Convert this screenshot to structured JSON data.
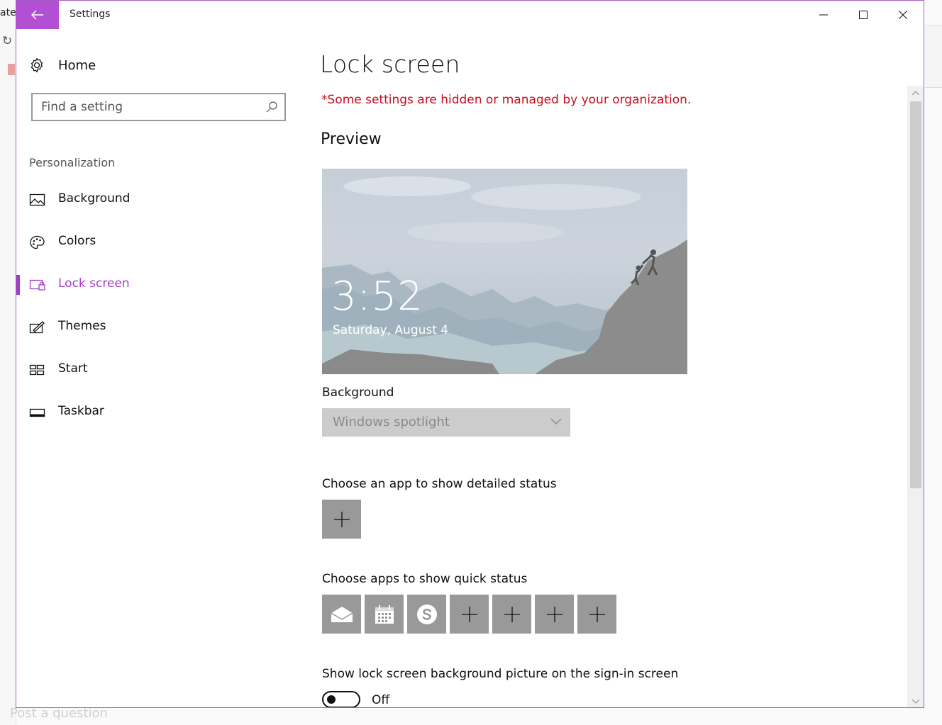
{
  "background_app": {
    "tab_fragment": "ate",
    "bottom_text": "Post a question"
  },
  "window": {
    "title": "Settings"
  },
  "sidebar": {
    "home_label": "Home",
    "search_placeholder": "Find a setting",
    "section_label": "Personalization",
    "items": [
      {
        "label": "Background",
        "icon": "picture-icon"
      },
      {
        "label": "Colors",
        "icon": "palette-icon"
      },
      {
        "label": "Lock screen",
        "icon": "lock-screen-icon",
        "active": true
      },
      {
        "label": "Themes",
        "icon": "themes-icon"
      },
      {
        "label": "Start",
        "icon": "start-icon"
      },
      {
        "label": "Taskbar",
        "icon": "taskbar-icon"
      }
    ]
  },
  "main": {
    "title": "Lock screen",
    "managed_notice": "*Some settings are hidden or managed by your organization.",
    "preview_heading": "Preview",
    "preview": {
      "time": "3:52",
      "date": "Saturday, August 4"
    },
    "background_label": "Background",
    "background_value": "Windows spotlight",
    "detailed_status_label": "Choose an app to show detailed status",
    "quick_status_label": "Choose apps to show quick status",
    "quick_status_apps": [
      "mail-icon",
      "calendar-icon",
      "skype-icon",
      "plus-icon",
      "plus-icon",
      "plus-icon",
      "plus-icon"
    ],
    "signin_label": "Show lock screen background picture on the sign-in screen",
    "signin_toggle": "Off"
  },
  "colors": {
    "accent": "#a23ec8",
    "back_button": "#b24fd3",
    "warning": "#c50f1f",
    "tile": "#999999"
  }
}
